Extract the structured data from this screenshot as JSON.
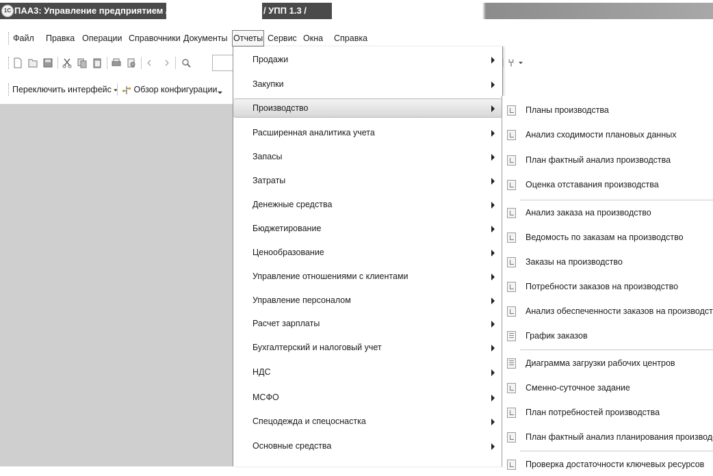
{
  "window": {
    "title": "ПАА3: Управление предприятием /",
    "title_suffix": "/ УПП 1.3 /"
  },
  "menubar": {
    "items": [
      "Файл",
      "Правка",
      "Операции",
      "Справочники",
      "Документы",
      "Отчеты",
      "Сервис",
      "Окна",
      "Справка"
    ],
    "active": "Отчеты"
  },
  "toolbar2": {
    "switch_interface": "Переключить интерфейс",
    "config_overview": "Обзор конфигурации"
  },
  "reports_menu": {
    "items": [
      "Продажи",
      "Закупки",
      "Производство",
      "Расширенная аналитика учета",
      "Запасы",
      "Затраты",
      "Денежные средства",
      "Бюджетирование",
      "Ценообразование",
      "Управление отношениями с клиентами",
      "Управление персоналом",
      "Расчет зарплаты",
      "Бухгалтерский и налоговый учет",
      "НДС",
      "МСФО",
      "Спецодежда и спецоснастка",
      "Основные средства"
    ],
    "highlighted": "Производство"
  },
  "production_submenu": {
    "items": [
      "Планы производства",
      "Анализ сходимости плановых данных",
      "План фактный анализ производства",
      "Оценка отставания производства",
      "Анализ заказа на производство",
      "Ведомость по заказам на производство",
      "Заказы на производство",
      "Потребности заказов на производство",
      "Анализ обеспеченности заказов на производство",
      "График заказов",
      "Диаграмма загрузки рабочих центров",
      "Сменно-суточное задание",
      "План потребностей производства",
      "План фактный анализ планирования производства",
      "Проверка достаточности ключевых ресурсов"
    ]
  },
  "colors": {
    "title_bar": "#4a4a4a",
    "workarea": "#cfcfcf",
    "highlight": "#d8d8d8"
  }
}
